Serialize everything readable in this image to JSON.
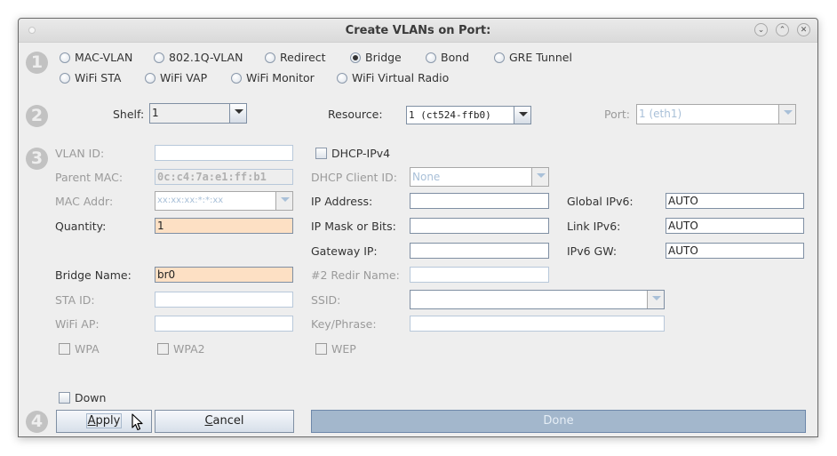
{
  "window": {
    "title": "Create VLANs on Port:",
    "controls": [
      "minimize",
      "maximize",
      "close"
    ]
  },
  "steps": [
    "1",
    "2",
    "3",
    "4"
  ],
  "vlan_types": {
    "row1": [
      {
        "label": "MAC-VLAN",
        "selected": false
      },
      {
        "label": "802.1Q-VLAN",
        "selected": false
      },
      {
        "label": "Redirect",
        "selected": false
      },
      {
        "label": "Bridge",
        "selected": true
      },
      {
        "label": "Bond",
        "selected": false
      },
      {
        "label": "GRE Tunnel",
        "selected": false
      }
    ],
    "row2": [
      {
        "label": "WiFi STA",
        "selected": false
      },
      {
        "label": "WiFi VAP",
        "selected": false
      },
      {
        "label": "WiFi Monitor",
        "selected": false
      },
      {
        "label": "WiFi Virtual Radio",
        "selected": false
      }
    ]
  },
  "location": {
    "shelf_label": "Shelf:",
    "shelf_value": "1",
    "resource_label": "Resource:",
    "resource_value": "1 (ct524-ffb0)",
    "port_label": "Port:",
    "port_value": "1 (eth1)"
  },
  "form": {
    "vlan_id": {
      "label": "VLAN ID:",
      "value": ""
    },
    "parent_mac": {
      "label": "Parent MAC:",
      "value": "0c:c4:7a:e1:ff:b1"
    },
    "mac_addr": {
      "label": "MAC Addr:",
      "value": "xx:xx:xx:*:*:xx"
    },
    "quantity": {
      "label": "Quantity:",
      "value": "1"
    },
    "bridge_name": {
      "label": "Bridge Name:",
      "value": "br0"
    },
    "sta_id": {
      "label": "STA ID:",
      "value": ""
    },
    "wifi_ap": {
      "label": "WiFi AP:",
      "value": ""
    },
    "wpa": {
      "label": "WPA",
      "checked": false
    },
    "wpa2": {
      "label": "WPA2",
      "checked": false
    },
    "dhcp_ipv4": {
      "label": "DHCP-IPv4",
      "checked": false
    },
    "dhcp_client_id": {
      "label": "DHCP Client ID:",
      "value": "None"
    },
    "ip_address": {
      "label": "IP Address:",
      "value": ""
    },
    "ip_mask": {
      "label": "IP Mask or Bits:",
      "value": ""
    },
    "gateway_ip": {
      "label": "Gateway IP:",
      "value": ""
    },
    "redir_name": {
      "label": "#2 Redir Name:",
      "value": ""
    },
    "ssid": {
      "label": "SSID:",
      "value": ""
    },
    "key_phrase": {
      "label": "Key/Phrase:",
      "value": ""
    },
    "wep": {
      "label": "WEP",
      "checked": false
    },
    "global_ipv6": {
      "label": "Global IPv6:",
      "value": "AUTO"
    },
    "link_ipv6": {
      "label": "Link IPv6:",
      "value": "AUTO"
    },
    "ipv6_gw": {
      "label": "IPv6 GW:",
      "value": "AUTO"
    }
  },
  "footer": {
    "down": {
      "label": "Down",
      "checked": false
    },
    "apply_mnemonic": "A",
    "apply_rest": "pply",
    "cancel_mnemonic": "C",
    "cancel_rest": "ancel",
    "done_label": "Done"
  }
}
